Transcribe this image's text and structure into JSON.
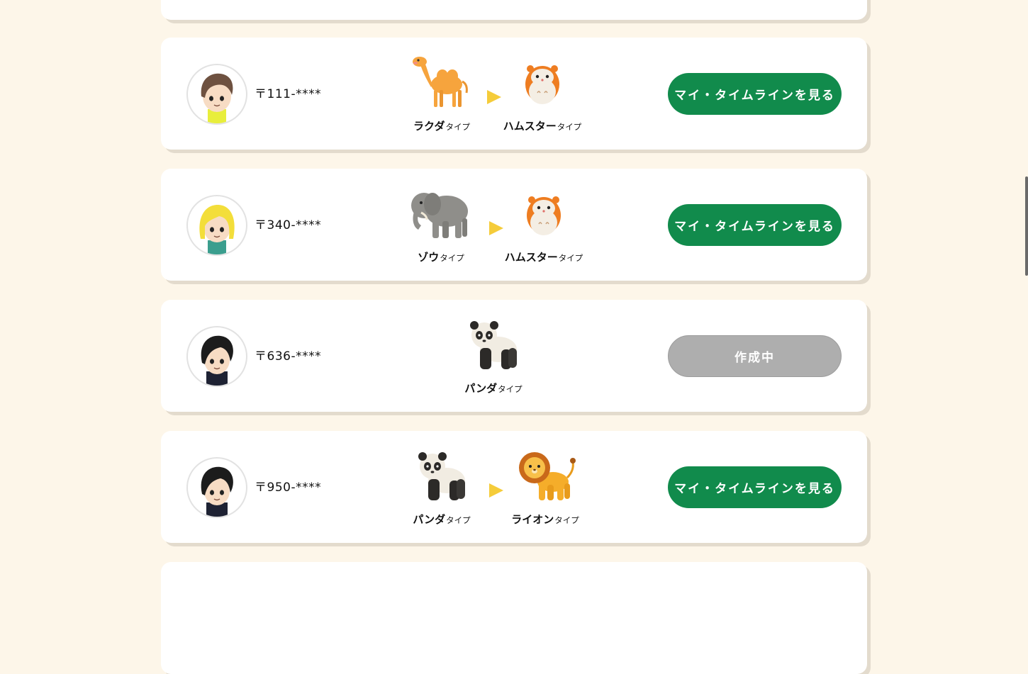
{
  "suffix": "タイプ",
  "rows": [
    {
      "postal": "〒111-****",
      "from": {
        "name": "ラクダ",
        "icon": "camel-icon"
      },
      "to": {
        "name": "ハムスター",
        "icon": "hamster-icon"
      },
      "button": {
        "label": "マイ・タイムラインを見る",
        "state": "active"
      }
    },
    {
      "postal": "〒340-****",
      "from": {
        "name": "ゾウ",
        "icon": "elephant-icon"
      },
      "to": {
        "name": "ハムスター",
        "icon": "hamster-icon"
      },
      "button": {
        "label": "マイ・タイムラインを見る",
        "state": "active"
      }
    },
    {
      "postal": "〒636-****",
      "from": {
        "name": "パンダ",
        "icon": "panda-icon"
      },
      "button": {
        "label": "作成中",
        "state": "disabled"
      }
    },
    {
      "postal": "〒950-****",
      "from": {
        "name": "パンダ",
        "icon": "panda-icon"
      },
      "to": {
        "name": "ライオン",
        "icon": "lion-icon"
      },
      "button": {
        "label": "マイ・タイムラインを見る",
        "state": "active"
      }
    }
  ],
  "colors": {
    "page_background": "#fdf6e9",
    "button_active": "#118b4c",
    "button_disabled": "#aeaeae",
    "arrow": "#f5cc3a"
  }
}
